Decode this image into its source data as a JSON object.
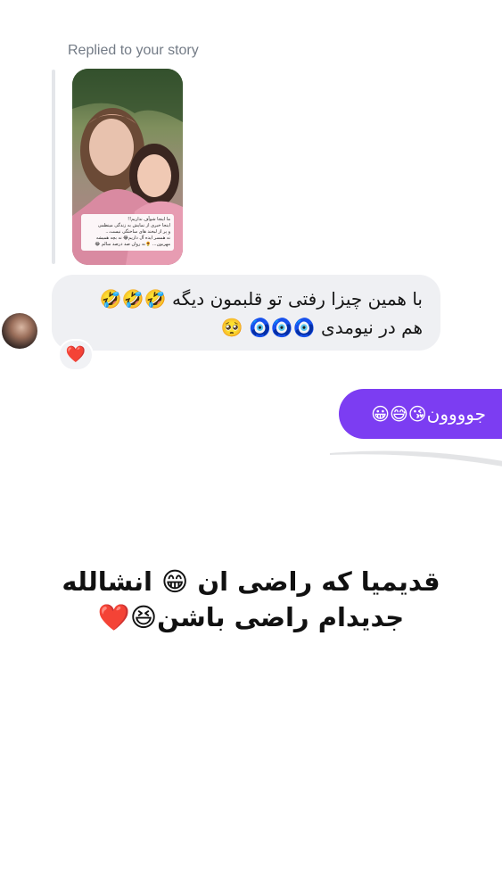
{
  "thread": {
    "reply_label": "Replied to your story",
    "story": {
      "caption_lines": [
        "ما اینجا شوآف نداریم!!",
        "اینجا خبری از نمایش به زندگی مینظمی",
        "و پر از لبخند های ساختگی نیست...",
        "نه همسر ایده آل داریم😂 نه بچه همیشه",
        "مهربون... 🌻نه روان صد درصد سالم 😂"
      ]
    },
    "incoming_message": {
      "line1": "با همین چیزا رفتی تو قلبمون دیگه 🤣🤣🤣",
      "line2": "هم در نیومدی 🧿🧿🧿 🥺",
      "reaction": "❤️"
    },
    "outgoing_message": {
      "text": "جوووون😘😅😀"
    }
  },
  "overlay": {
    "line1": "قدیمیا که راضی ان 😁 انشالله",
    "line2": "جدیدام راضی باشن😆❤️"
  }
}
